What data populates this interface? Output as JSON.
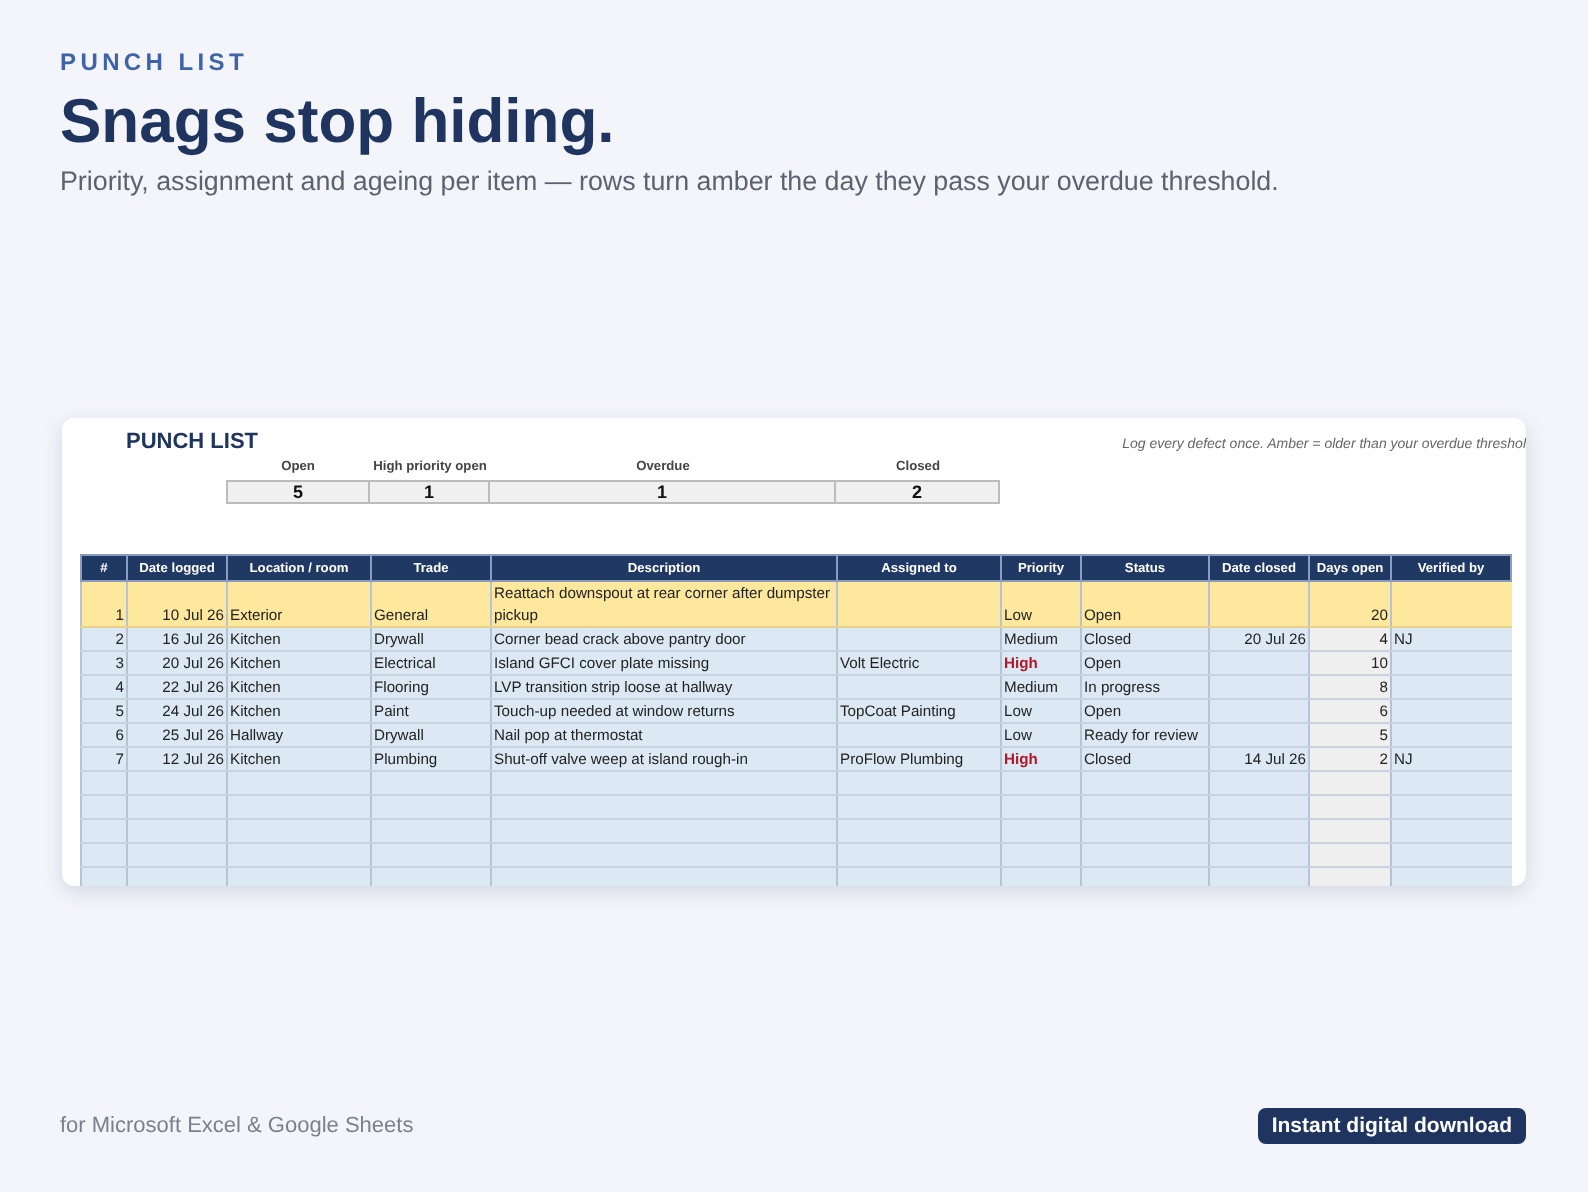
{
  "eyebrow": "PUNCH LIST",
  "headline": "Snags stop hiding.",
  "subtitle": "Priority, assignment and ageing per item — rows turn amber the day they pass your overdue threshold.",
  "sheet": {
    "title": "PUNCH LIST",
    "note": "Log every defect once. Amber = older than your overdue threshol",
    "summary": [
      {
        "label": "Open",
        "value": "5"
      },
      {
        "label": "High priority open",
        "value": "1"
      },
      {
        "label": "Overdue",
        "value": "1"
      },
      {
        "label": "Closed",
        "value": "2"
      }
    ],
    "columns": [
      "#",
      "Date logged",
      "Location / room",
      "Trade",
      "Description",
      "Assigned to",
      "Priority",
      "Status",
      "Date closed",
      "Days open",
      "Verified by"
    ],
    "rows": [
      {
        "num": "1",
        "date_logged": "10 Jul 26",
        "location": "Exterior",
        "trade": "General",
        "description": "Reattach downspout at rear corner after dumpster pickup",
        "assigned_to": "",
        "priority": "Low",
        "high_priority": false,
        "status": "Open",
        "date_closed": "",
        "days_open": "20",
        "verified_by": "",
        "overdue": true
      },
      {
        "num": "2",
        "date_logged": "16 Jul 26",
        "location": "Kitchen",
        "trade": "Drywall",
        "description": "Corner bead crack above pantry door",
        "assigned_to": "",
        "priority": "Medium",
        "high_priority": false,
        "status": "Closed",
        "date_closed": "20 Jul 26",
        "days_open": "4",
        "verified_by": "NJ",
        "overdue": false
      },
      {
        "num": "3",
        "date_logged": "20 Jul 26",
        "location": "Kitchen",
        "trade": "Electrical",
        "description": "Island GFCI cover plate missing",
        "assigned_to": "Volt Electric",
        "priority": "High",
        "high_priority": true,
        "status": "Open",
        "date_closed": "",
        "days_open": "10",
        "verified_by": "",
        "overdue": false
      },
      {
        "num": "4",
        "date_logged": "22 Jul 26",
        "location": "Kitchen",
        "trade": "Flooring",
        "description": "LVP transition strip loose at hallway",
        "assigned_to": "",
        "priority": "Medium",
        "high_priority": false,
        "status": "In progress",
        "date_closed": "",
        "days_open": "8",
        "verified_by": "",
        "overdue": false
      },
      {
        "num": "5",
        "date_logged": "24 Jul 26",
        "location": "Kitchen",
        "trade": "Paint",
        "description": "Touch-up needed at window returns",
        "assigned_to": "TopCoat Painting",
        "priority": "Low",
        "high_priority": false,
        "status": "Open",
        "date_closed": "",
        "days_open": "6",
        "verified_by": "",
        "overdue": false
      },
      {
        "num": "6",
        "date_logged": "25 Jul 26",
        "location": "Hallway",
        "trade": "Drywall",
        "description": "Nail pop at thermostat",
        "assigned_to": "",
        "priority": "Low",
        "high_priority": false,
        "status": "Ready for review",
        "date_closed": "",
        "days_open": "5",
        "verified_by": "",
        "overdue": false
      },
      {
        "num": "7",
        "date_logged": "12 Jul 26",
        "location": "Kitchen",
        "trade": "Plumbing",
        "description": "Shut-off valve weep at island rough-in",
        "assigned_to": "ProFlow Plumbing",
        "priority": "High",
        "high_priority": true,
        "status": "Closed",
        "date_closed": "14 Jul 26",
        "days_open": "2",
        "verified_by": "NJ",
        "overdue": false
      }
    ]
  },
  "footer": {
    "note": "for Microsoft Excel & Google Sheets",
    "badge": "Instant digital download"
  }
}
